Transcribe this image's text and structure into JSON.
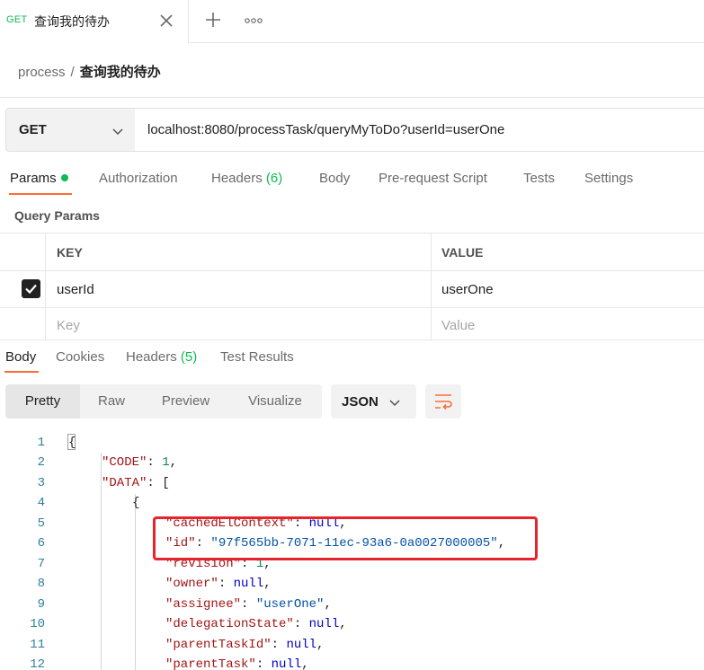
{
  "tab": {
    "method": "GET",
    "title": "查询我的待办"
  },
  "breadcrumb": {
    "parent": "process",
    "separator": "/",
    "current": "查询我的待办"
  },
  "request": {
    "method": "GET",
    "url": "localhost:8080/processTask/queryMyToDo?userId=userOne"
  },
  "request_tabs": [
    {
      "label": "Params",
      "count": ""
    },
    {
      "label": "Authorization",
      "count": ""
    },
    {
      "label": "Headers",
      "count": "(6)"
    },
    {
      "label": "Body",
      "count": ""
    },
    {
      "label": "Pre-request Script",
      "count": ""
    },
    {
      "label": "Tests",
      "count": ""
    },
    {
      "label": "Settings",
      "count": ""
    }
  ],
  "query_params": {
    "title": "Query Params",
    "headers": {
      "key": "KEY",
      "value": "VALUE"
    },
    "rows": [
      {
        "checked": true,
        "key": "userId",
        "value": "userOne"
      }
    ],
    "placeholder": {
      "key": "Key",
      "value": "Value"
    }
  },
  "response_tabs": [
    {
      "label": "Body",
      "count": ""
    },
    {
      "label": "Cookies",
      "count": ""
    },
    {
      "label": "Headers",
      "count": "(5)"
    },
    {
      "label": "Test Results",
      "count": ""
    }
  ],
  "view_modes": [
    "Pretty",
    "Raw",
    "Preview",
    "Visualize"
  ],
  "active_view": "Pretty",
  "format": "JSON",
  "code_lines": [
    {
      "n": "1",
      "text": "{"
    },
    {
      "n": "2",
      "text": "\"CODE\": 1,"
    },
    {
      "n": "3",
      "text": "\"DATA\": ["
    },
    {
      "n": "4",
      "text": "{"
    },
    {
      "n": "5",
      "text": "\"cachedElContext\": null,"
    },
    {
      "n": "6",
      "text": "\"id\": \"97f565bb-7071-11ec-93a6-0a0027000005\","
    },
    {
      "n": "7",
      "text": "\"revision\": 1,"
    },
    {
      "n": "8",
      "text": "\"owner\": null,"
    },
    {
      "n": "9",
      "text": "\"assignee\": \"userOne\","
    },
    {
      "n": "10",
      "text": "\"delegationState\": null,"
    },
    {
      "n": "11",
      "text": "\"parentTaskId\": null,"
    },
    {
      "n": "12",
      "text": "\"parentTask\": null,"
    }
  ],
  "colors": {
    "accent": "#ff6c37",
    "success": "#0cbb52",
    "annotation": "#e8242b"
  }
}
